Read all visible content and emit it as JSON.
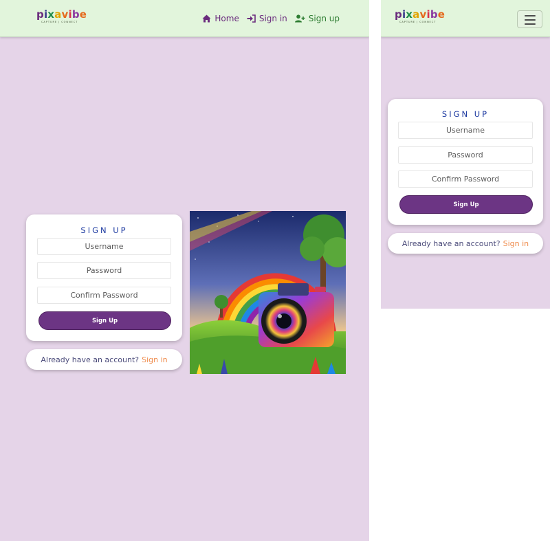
{
  "brand": {
    "name": "pixavibe",
    "tagline": "CAPTURE | CONNECT"
  },
  "nav": {
    "home": {
      "label": "Home",
      "icon": "house-icon"
    },
    "signin": {
      "label": "Sign in",
      "icon": "sign-in-icon"
    },
    "signup": {
      "label": "Sign up",
      "icon": "user-plus-icon"
    }
  },
  "form": {
    "title": "SIGN UP",
    "username_placeholder": "Username",
    "password_placeholder": "Password",
    "confirm_placeholder": "Confirm Password",
    "submit_label": "Sign Up"
  },
  "signin_prompt": {
    "text": "Already have an account?",
    "link": "Sign in"
  },
  "hero_image": {
    "subject": "rainbow camera illustration"
  },
  "colors": {
    "page_background": "#e5d4e8",
    "navbar_background": "#e2f5dc",
    "primary_button": "#6c3584",
    "title": "#1d3aa0",
    "link_accent": "#ef8a4a",
    "signup_link": "#2e7d32"
  },
  "mobile_menu": {
    "icon": "hamburger-icon"
  }
}
